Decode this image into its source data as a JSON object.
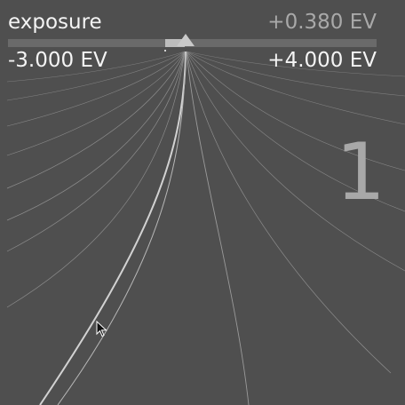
{
  "slider": {
    "name": "exposure",
    "value_text": "+0.380 EV",
    "min_text": "-3.000 EV",
    "max_text": "+4.000 EV",
    "value": 0.38,
    "min": -3.0,
    "max": 4.0
  },
  "fine_tune": {
    "step_indicator": "1"
  },
  "icons": {
    "cursor": "arrow-pointer-icon",
    "handle": "slider-handle-triangle-icon"
  },
  "colors": {
    "background": "#4f4f4f",
    "text": "#f4f4f4",
    "value_text": "#a9a9a9",
    "track": "#6a6a6a",
    "fill": "#bdbdbd",
    "step_indicator": "#a8a8a8",
    "curves": "#9c9c9c"
  }
}
